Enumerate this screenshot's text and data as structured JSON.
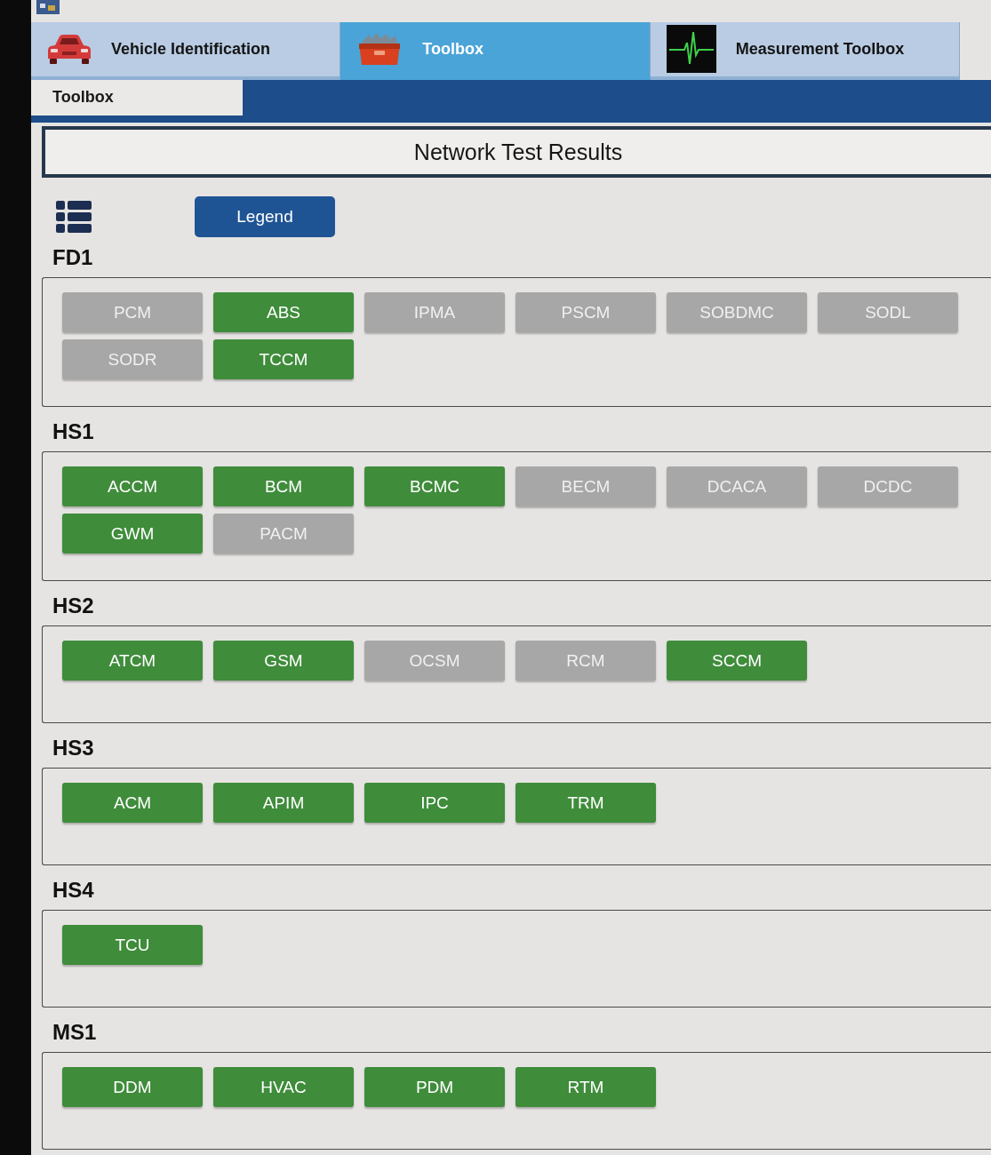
{
  "tabs": [
    {
      "label": "Vehicle Identification",
      "kind": "vehicle",
      "selected": false
    },
    {
      "label": "Toolbox",
      "kind": "toolbox",
      "selected": true
    },
    {
      "label": "Measurement Toolbox",
      "kind": "measurement",
      "selected": false
    }
  ],
  "subtabs": [
    {
      "label": "Toolbox",
      "selected": true
    }
  ],
  "panel": {
    "title": "Network Test Results",
    "legend_button": "Legend"
  },
  "networks": [
    {
      "name": "FD1",
      "modules": [
        {
          "name": "PCM",
          "responded": false
        },
        {
          "name": "ABS",
          "responded": true
        },
        {
          "name": "IPMA",
          "responded": false
        },
        {
          "name": "PSCM",
          "responded": false
        },
        {
          "name": "SOBDMC",
          "responded": false
        },
        {
          "name": "SODL",
          "responded": false
        },
        {
          "name": "SODR",
          "responded": false
        },
        {
          "name": "TCCM",
          "responded": true
        }
      ]
    },
    {
      "name": "HS1",
      "modules": [
        {
          "name": "ACCM",
          "responded": true
        },
        {
          "name": "BCM",
          "responded": true
        },
        {
          "name": "BCMC",
          "responded": true
        },
        {
          "name": "BECM",
          "responded": false
        },
        {
          "name": "DCACA",
          "responded": false
        },
        {
          "name": "DCDC",
          "responded": false
        },
        {
          "name": "GWM",
          "responded": true
        },
        {
          "name": "PACM",
          "responded": false
        }
      ]
    },
    {
      "name": "HS2",
      "modules": [
        {
          "name": "ATCM",
          "responded": true
        },
        {
          "name": "GSM",
          "responded": true
        },
        {
          "name": "OCSM",
          "responded": false
        },
        {
          "name": "RCM",
          "responded": false
        },
        {
          "name": "SCCM",
          "responded": true
        }
      ]
    },
    {
      "name": "HS3",
      "modules": [
        {
          "name": "ACM",
          "responded": true
        },
        {
          "name": "APIM",
          "responded": true
        },
        {
          "name": "IPC",
          "responded": true
        },
        {
          "name": "TRM",
          "responded": true
        }
      ]
    },
    {
      "name": "HS4",
      "modules": [
        {
          "name": "TCU",
          "responded": true
        }
      ]
    },
    {
      "name": "MS1",
      "modules": [
        {
          "name": "DDM",
          "responded": true
        },
        {
          "name": "HVAC",
          "responded": true
        },
        {
          "name": "PDM",
          "responded": true
        },
        {
          "name": "RTM",
          "responded": true
        }
      ]
    }
  ]
}
